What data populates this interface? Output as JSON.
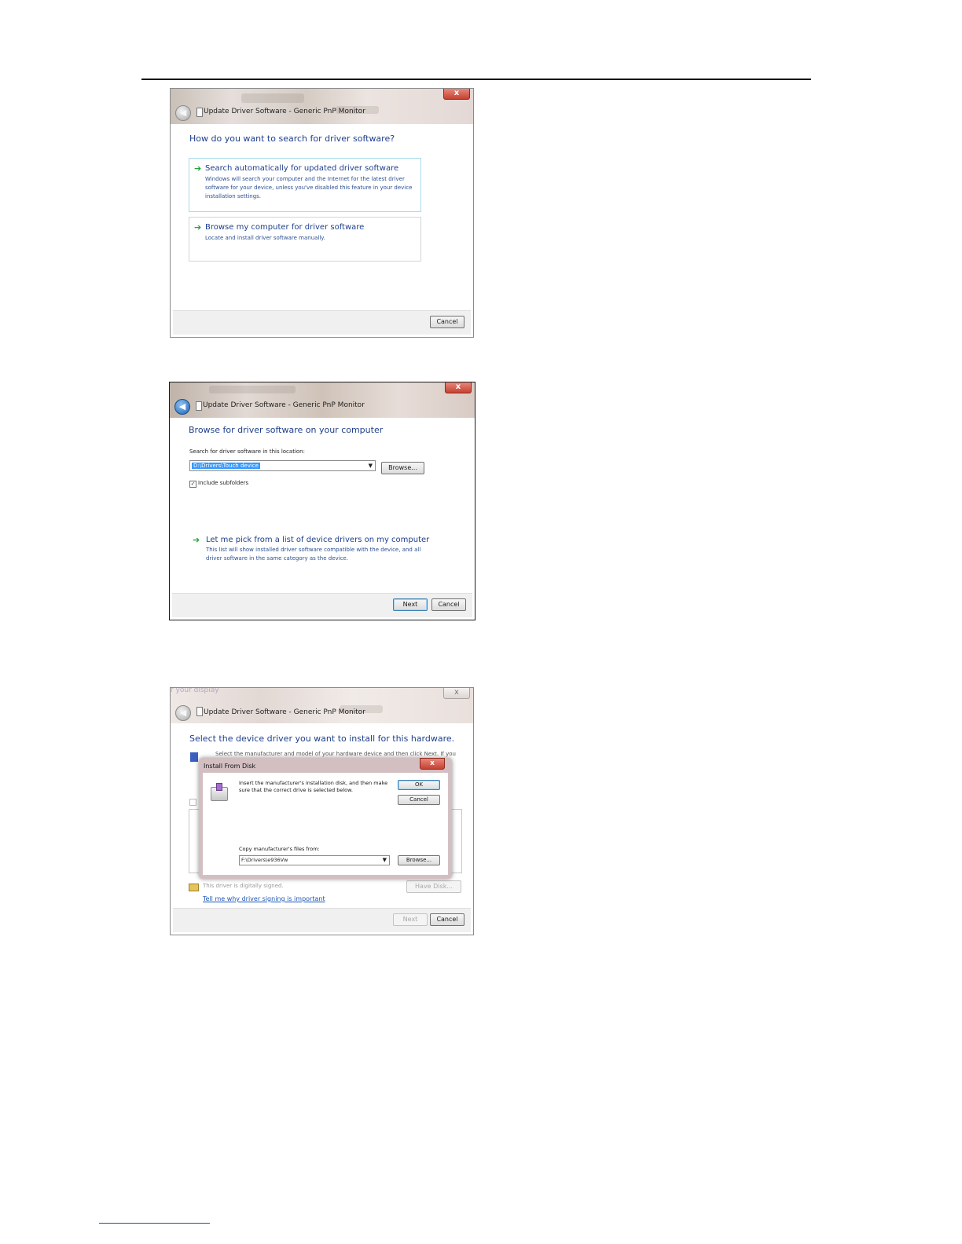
{
  "window_title": "Update Driver Software - Generic PnP Monitor",
  "close_glyph": "x",
  "screen1": {
    "heading": "How do you want to search for driver software?",
    "option1": {
      "title": "Search automatically for updated driver software",
      "description": "Windows will search your computer and the Internet for the latest driver software for your device, unless you've disabled this feature in your device installation settings."
    },
    "option2": {
      "title": "Browse my computer for driver software",
      "description": "Locate and install driver software manually."
    },
    "cancel_label": "Cancel"
  },
  "screen2": {
    "heading": "Browse for driver software on your computer",
    "search_label": "Search for driver software in this location:",
    "path_value": "D:\\Drivers\\Touch device",
    "browse_label": "Browse...",
    "include_subfolders_label": "Include subfolders",
    "pick_title": "Let me pick from a list of device drivers on my computer",
    "pick_description": "This list will show installed driver software compatible with the device, and all driver software in the same category as the device.",
    "next_label": "Next",
    "cancel_label": "Cancel"
  },
  "screen3": {
    "partial_top_text": "r your display",
    "heading": "Select the device driver you want to install for this hardware.",
    "background_instruction": "Select the manufacturer and model of your hardware device and then click Next. If you",
    "signed_text": "This driver is digitally signed.",
    "signing_link": "Tell me why driver signing is important",
    "have_disk_label": "Have Disk...",
    "next_label": "Next",
    "cancel_label": "Cancel",
    "install_from_disk": {
      "title": "Install From Disk",
      "message": "Insert the manufacturer's installation disk, and then make sure that the correct drive is selected below.",
      "ok_label": "OK",
      "cancel_label": "Cancel",
      "copy_label": "Copy manufacturer's files from:",
      "path_value": "F:\\Drivers\\e936Vw",
      "browse_label": "Browse..."
    }
  }
}
